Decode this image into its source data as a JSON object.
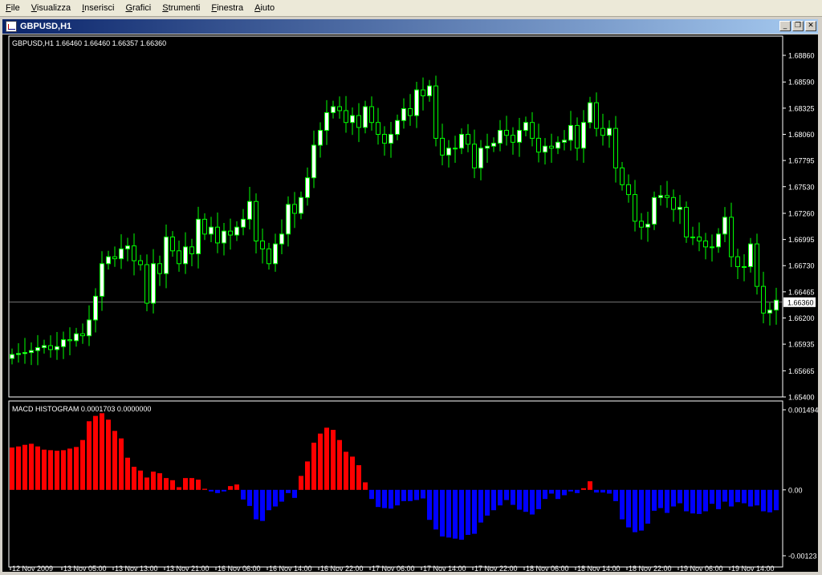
{
  "menu": [
    "File",
    "Visualizza",
    "Inserisci",
    "Grafici",
    "Strumenti",
    "Finestra",
    "Aiuto"
  ],
  "window": {
    "title": "GBPUSD,H1",
    "minimize_icon": "minimize-icon",
    "restore_icon": "restore-icon",
    "close_icon": "close-icon"
  },
  "colors": {
    "background": "#000000",
    "candle": "#00ff00",
    "bull_body": "#ffffff",
    "hist_positive": "#ff0000",
    "hist_negative": "#0000ff",
    "price_line": "#c0c0c0"
  },
  "chart_data": [
    {
      "type": "candlestick",
      "title": "GBPUSD,H1  1.66460 1.66460 1.66357 1.66360",
      "ylim": [
        1.654,
        1.6886
      ],
      "yticks": [
        "1.68860",
        "1.68590",
        "1.68325",
        "1.68060",
        "1.67795",
        "1.67530",
        "1.67260",
        "1.66995",
        "1.66730",
        "1.66465",
        "1.66200",
        "1.65935",
        "1.65665",
        "1.65400"
      ],
      "current_price": "1.66360",
      "closes": [
        1.6583,
        1.6584,
        1.6585,
        1.6587,
        1.659,
        1.6592,
        1.6588,
        1.6591,
        1.6598,
        1.6597,
        1.6604,
        1.6602,
        1.6618,
        1.6642,
        1.6675,
        1.6682,
        1.668,
        1.669,
        1.6693,
        1.6678,
        1.6674,
        1.6635,
        1.6675,
        1.6665,
        1.6702,
        1.6688,
        1.6675,
        1.6692,
        1.6685,
        1.672,
        1.6705,
        1.6712,
        1.6696,
        1.6708,
        1.6704,
        1.6712,
        1.672,
        1.6738,
        1.6698,
        1.669,
        1.6675,
        1.6695,
        1.6705,
        1.6735,
        1.6726,
        1.6742,
        1.6762,
        1.6795,
        1.681,
        1.6828,
        1.6834,
        1.683,
        1.6818,
        1.6825,
        1.6813,
        1.6834,
        1.6818,
        1.6806,
        1.6797,
        1.6806,
        1.682,
        1.6832,
        1.6825,
        1.6851,
        1.6845,
        1.6855,
        1.6802,
        1.6785,
        1.6792,
        1.6792,
        1.6806,
        1.6796,
        1.6772,
        1.6792,
        1.6794,
        1.6797,
        1.681,
        1.6805,
        1.6798,
        1.681,
        1.6818,
        1.6802,
        1.6788,
        1.6794,
        1.6792,
        1.6798,
        1.68,
        1.6815,
        1.6792,
        1.6818,
        1.6838,
        1.6812,
        1.6805,
        1.6812,
        1.6772,
        1.6755,
        1.6745,
        1.6718,
        1.6712,
        1.6715,
        1.6742,
        1.6744,
        1.6742,
        1.673,
        1.6732,
        1.6702,
        1.6702,
        1.6698,
        1.6692,
        1.6692,
        1.6705,
        1.6722,
        1.6682,
        1.6672,
        1.6672,
        1.6695,
        1.6652,
        1.6625,
        1.6628,
        1.6638,
        1.6615,
        1.6618,
        1.6632,
        1.6655,
        1.6645,
        1.6642,
        1.6636
      ],
      "x_labels": [
        "12 Nov 2009",
        "13 Nov 05:00",
        "13 Nov 13:00",
        "13 Nov 21:00",
        "16 Nov 06:00",
        "16 Nov 14:00",
        "16 Nov 22:00",
        "17 Nov 06:00",
        "17 Nov 14:00",
        "17 Nov 22:00",
        "18 Nov 06:00",
        "18 Nov 14:00",
        "18 Nov 22:00",
        "19 Nov 06:00",
        "19 Nov 14:00"
      ]
    },
    {
      "type": "bar",
      "title": "MACD HISTOGRAM 0.0001703 0.0000000",
      "ylim": [
        -0.00123,
        0.001494
      ],
      "yticks": [
        "0.001494",
        "0.00",
        "-0.00123"
      ],
      "values": [
        0.00079,
        0.00081,
        0.00084,
        0.00086,
        0.00081,
        0.00075,
        0.00074,
        0.00073,
        0.00074,
        0.00077,
        0.0008,
        0.00093,
        0.00128,
        0.00138,
        0.00143,
        0.00131,
        0.0011,
        0.00096,
        0.0006,
        0.00043,
        0.00036,
        0.00023,
        0.00034,
        0.00031,
        0.00022,
        0.00018,
        5e-05,
        0.00022,
        0.00022,
        0.00019,
        2e-05,
        -3e-05,
        -6e-05,
        -3e-05,
        7e-05,
        0.0001,
        -0.00018,
        -0.0003,
        -0.00055,
        -0.00058,
        -0.00038,
        -0.00031,
        -0.00022,
        -6e-05,
        -0.00015,
        0.00026,
        0.00053,
        0.00088,
        0.00105,
        0.00116,
        0.00112,
        0.00093,
        0.00071,
        0.00062,
        0.00046,
        0.00014,
        -0.00017,
        -0.00032,
        -0.00034,
        -0.00035,
        -0.00029,
        -0.00021,
        -0.00021,
        -0.00019,
        -0.00016,
        -0.00056,
        -0.00074,
        -0.00087,
        -0.00089,
        -0.00091,
        -0.00093,
        -0.00084,
        -0.00082,
        -0.00061,
        -0.00048,
        -0.00038,
        -0.00029,
        -0.00019,
        -0.00028,
        -0.00037,
        -0.00041,
        -0.00046,
        -0.00036,
        -0.00017,
        -7e-05,
        -0.00017,
        -0.0001,
        -3e-05,
        -6e-05,
        3e-05,
        0.00016,
        -5e-05,
        -5e-05,
        -7e-05,
        -0.00021,
        -0.00055,
        -0.0007,
        -0.00079,
        -0.00076,
        -0.00063,
        -0.00039,
        -0.00034,
        -0.00043,
        -0.00031,
        -0.00025,
        -0.0004,
        -0.00044,
        -0.00045,
        -0.0004,
        -0.00026,
        -0.00036,
        -0.00022,
        -0.00031,
        -0.00023,
        -0.00025,
        -0.00031,
        -0.00029,
        -0.0004,
        -0.00042,
        -0.00038,
        -0.00041,
        -0.00038,
        -0.00042,
        -0.00021,
        -0.00012,
        -6e-05,
        0.00018,
        0.00028
      ]
    }
  ]
}
